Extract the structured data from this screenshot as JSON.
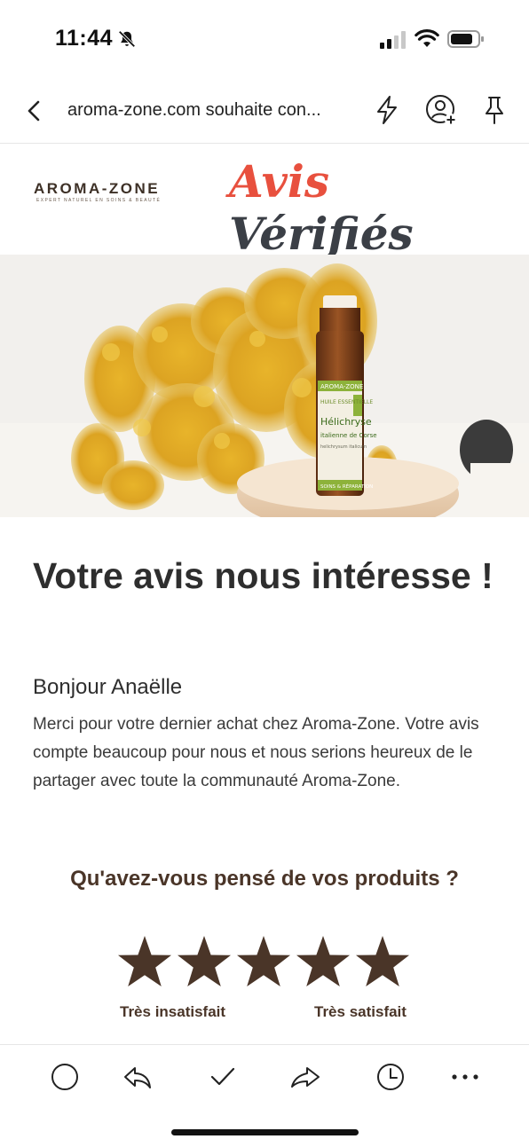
{
  "status_bar": {
    "time": "11:44",
    "icons": [
      "bell-slash-icon",
      "cellular-signal-icon",
      "wifi-icon",
      "battery-icon"
    ]
  },
  "header": {
    "title": "aroma-zone.com souhaite con...",
    "icons": [
      "back-chevron-icon",
      "lightning-icon",
      "add-contact-icon",
      "pin-icon"
    ]
  },
  "email": {
    "brand_logo": {
      "name": "AROMA-ZONE",
      "tagline": "EXPERT NATUREL EN SOINS & BEAUTÉ"
    },
    "partner_logo": {
      "part1": "Avis",
      "part2": "Vérifiés"
    },
    "hero_bottle_label": {
      "brand": "AROMA-ZONE",
      "type": "HUILE ESSENTIELLE",
      "name": "Hélichryse",
      "variety": "italienne de Corse",
      "latin": "helichrysum italicum",
      "footer": "SOINS & RÉPARATION"
    },
    "headline": "Votre avis nous intéresse !",
    "greeting": "Bonjour Anaëlle",
    "body": "Merci pour votre dernier achat chez Aroma-Zone. Votre avis compte beaucoup pour nous et nous serions heureux de le partager avec toute la communauté Aroma-Zone.",
    "question": "Qu'avez-vous pensé de vos produits ?",
    "rating": {
      "max_stars": 5,
      "low_label": "Très insatisfait",
      "high_label": "Très satisfait"
    }
  },
  "actions": [
    "circle-icon",
    "reply-icon",
    "checkmark-icon",
    "forward-icon",
    "clock-icon",
    "more-icon"
  ],
  "colors": {
    "brand_brown": "#4a3528",
    "avis_red": "#e8503e",
    "avis_dark": "#3b3f46",
    "text": "#2e2e2e"
  }
}
